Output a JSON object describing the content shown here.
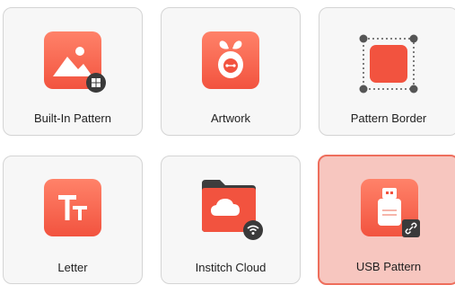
{
  "tiles": [
    {
      "label": "Built-In Pattern",
      "icon": "image-icon",
      "selected": false
    },
    {
      "label": "Artwork",
      "icon": "artwork-icon",
      "selected": false
    },
    {
      "label": "Pattern Border",
      "icon": "pattern-border-icon",
      "selected": false
    },
    {
      "label": "Letter",
      "icon": "letter-icon",
      "selected": false
    },
    {
      "label": "Institch Cloud",
      "icon": "cloud-folder-icon",
      "selected": false
    },
    {
      "label": "USB Pattern",
      "icon": "usb-drive-icon",
      "selected": true
    }
  ],
  "colors": {
    "accent": "#f2533f",
    "selected_bg": "#f7c6bf",
    "selected_border": "#ee6e5c",
    "tile_bg": "#f7f7f7"
  }
}
